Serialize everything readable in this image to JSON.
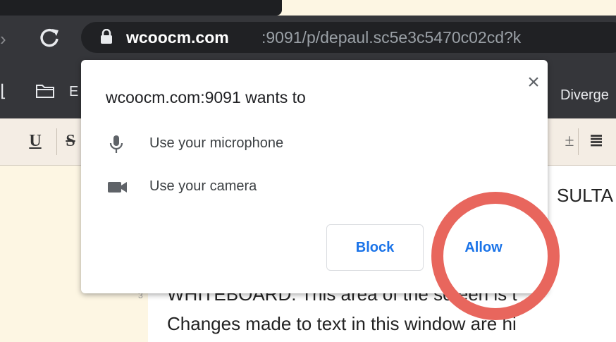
{
  "browser": {
    "url_host": "wcoocm.com",
    "url_rest": ":9091/p/depaul.sc5e3c5470c02cd?k"
  },
  "bookmarks": {
    "left_label": "E",
    "right_label": "Diverge"
  },
  "editor": {
    "toolbar": {
      "underline": "U",
      "strike": "S",
      "right_glyph": "±",
      "align_glyph": "≣"
    },
    "text_partial_right": "SULTA",
    "line1": "WHITEBOARD: This area of the screen is t",
    "line2": "Changes made to text in this window are hi",
    "gutter_mark": "3"
  },
  "permission_dialog": {
    "title": "wcoocm.com:9091 wants to",
    "permissions": [
      {
        "icon": "microphone-icon",
        "label": "Use your microphone"
      },
      {
        "icon": "camera-icon",
        "label": "Use your camera"
      }
    ],
    "block_label": "Block",
    "allow_label": "Allow"
  },
  "annotation": {
    "highlight_color": "#e8665d"
  }
}
